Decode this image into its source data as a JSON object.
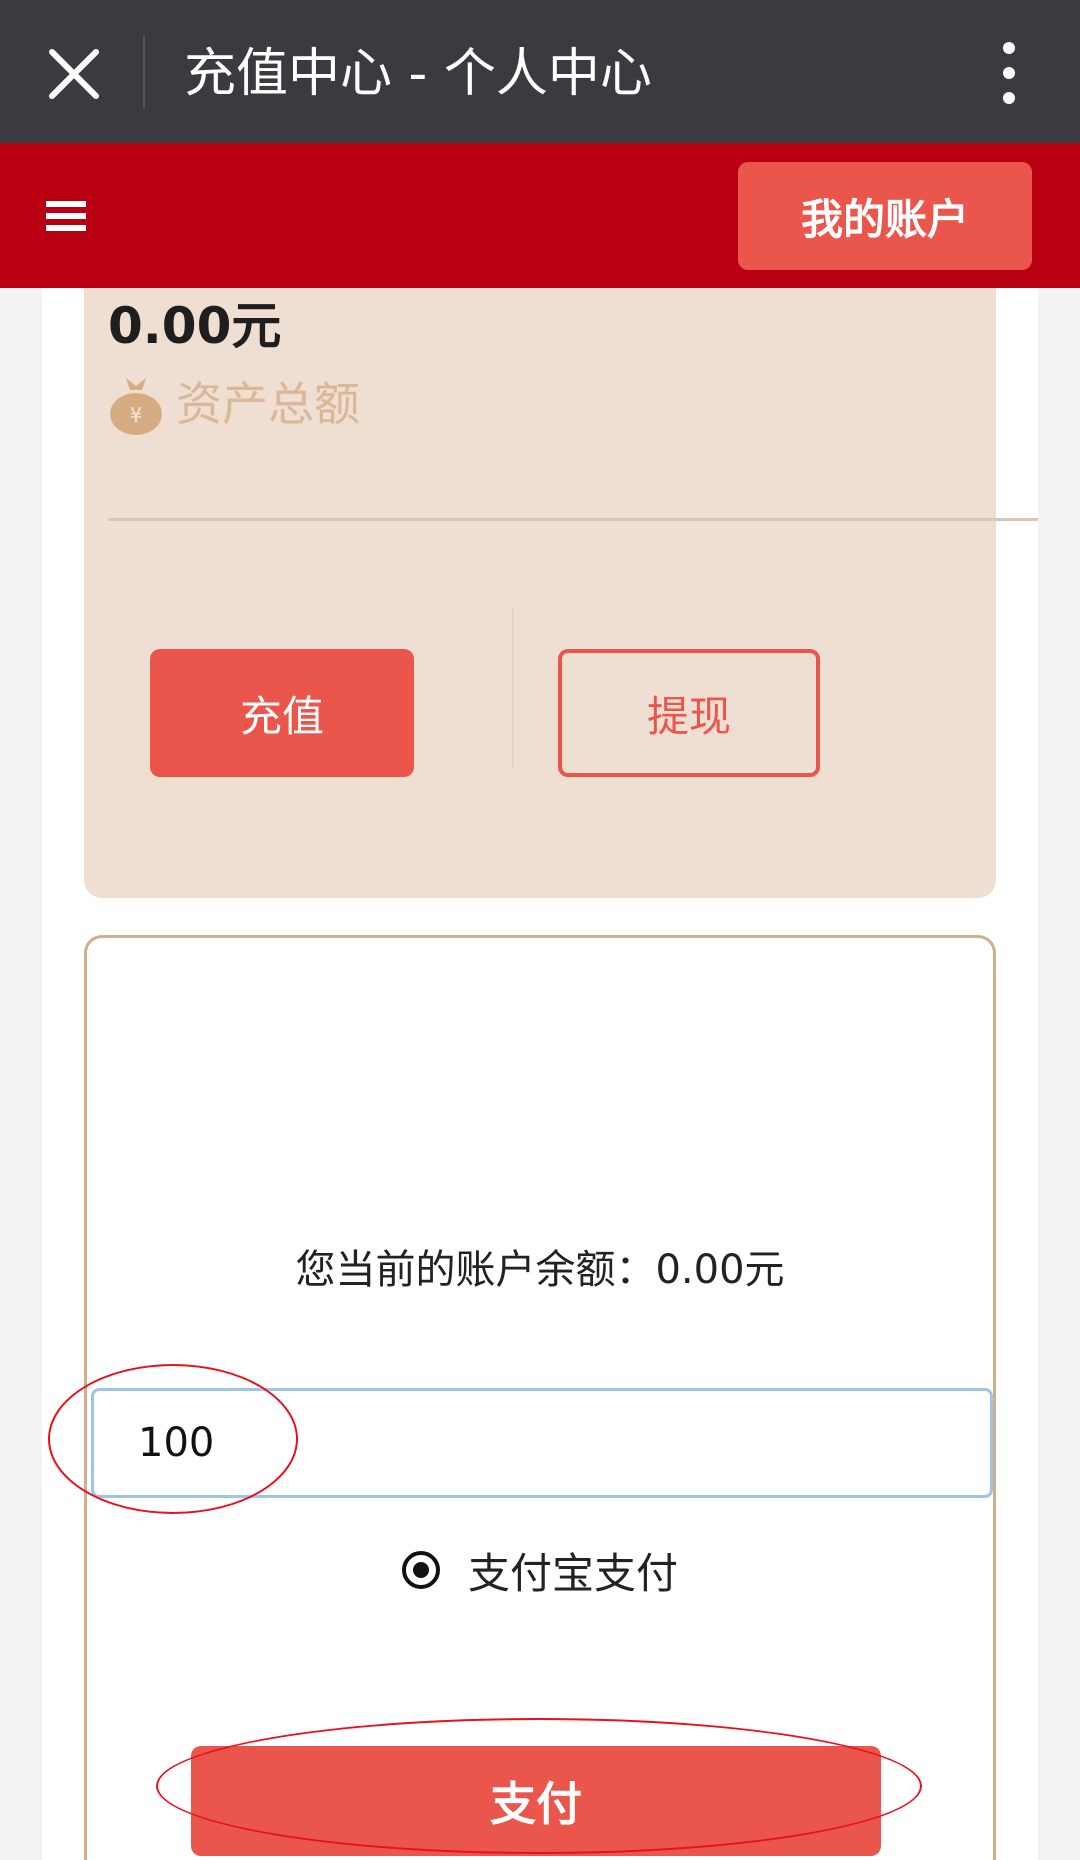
{
  "titlebar": {
    "title": "充值中心 - 个人中心",
    "close_icon": "close-icon",
    "more_icon": "more-vertical-icon"
  },
  "navbar": {
    "menu_icon": "menu-icon",
    "account_button": "我的账户"
  },
  "asset_card": {
    "amount": "0.00元",
    "label": "资产总额",
    "label_icon": "money-bag-icon",
    "recharge_button": "充值",
    "withdraw_button": "提现"
  },
  "pay_card": {
    "balance_text": "您当前的账户余额：0.00元",
    "amount_input_value": "100",
    "payment_option": "支付宝支付",
    "payment_selected": true,
    "pay_button": "支付"
  },
  "colors": {
    "titlebar_bg": "#3a3a3f",
    "navbar_bg": "#b90012",
    "accent": "#eb564c",
    "card_bg": "#efdfd3",
    "annotation": "#e8101a"
  }
}
